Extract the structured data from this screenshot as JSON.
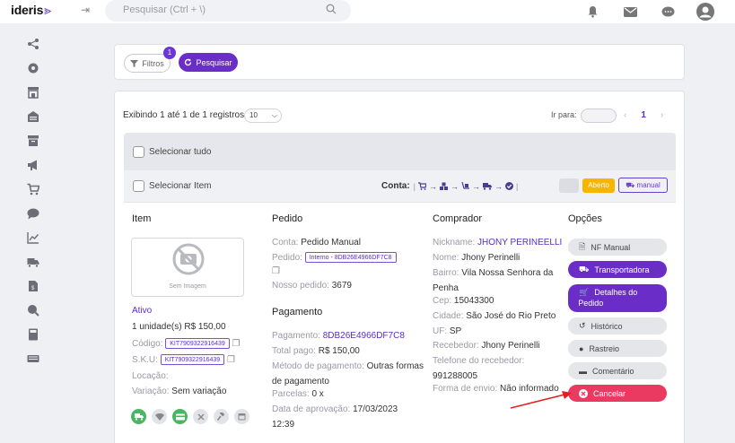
{
  "app": {
    "logo": "ideris"
  },
  "search": {
    "placeholder": "Pesquisar (Ctrl + \\)"
  },
  "filters": {
    "filtros_label": "Filtros",
    "filtros_count": "1",
    "pesquisar_label": "Pesquisar"
  },
  "results": {
    "showing": "Exibindo 1 até 1 de 1 registros",
    "per_page": "10",
    "ir_para_label": "Ir para:",
    "current_page": "1",
    "select_all_label": "Selecionar tudo",
    "select_item_label": "Selecionar Item",
    "conta_label": "Conta:",
    "status_aberto": "Aberto",
    "status_manual": "manual"
  },
  "item": {
    "heading": "Item",
    "no_image_caption": "Sem Imagem",
    "status": "Ativo",
    "quantity_price": "1 unidade(s) R$ 150,00",
    "codigo_label": "Código:",
    "codigo_value": "KIT7909322916439",
    "sku_label": "S.K.U:",
    "sku_value": "KIT7909322916439",
    "localizacao_label": "Locação:",
    "variacao_label": "Variação:",
    "variacao_value": "Sem variação"
  },
  "pedido": {
    "heading": "Pedido",
    "conta_label": "Conta:",
    "conta_value": "Pedido Manual",
    "pedido_label": "Pedido:",
    "pedido_value": "Interno - 8DB26E4966DF7C8",
    "nosso_label": "Nosso pedido:",
    "nosso_value": "3679"
  },
  "pagamento": {
    "heading": "Pagamento",
    "pag_label": "Pagamento:",
    "pag_value": "8DB26E4966DF7C8",
    "total_label": "Total pago:",
    "total_value": "R$ 150,00",
    "metodo_label": "Método de pagamento:",
    "metodo_value_1": "Outras formas",
    "metodo_value_2": "de pagamento",
    "parcelas_label": "Parcelas:",
    "parcelas_value": "0 x",
    "data_label": "Data de aprovação:",
    "data_value_1": "17/03/2023",
    "data_value_2": "12:39"
  },
  "comprador": {
    "heading": "Comprador",
    "nickname_label": "Nickname:",
    "nickname_value": "JHONY PERINEELLI",
    "nome_label": "Nome:",
    "nome_value": "Jhony Perinelli",
    "bairro_label": "Bairro:",
    "bairro_value_1": "Vila Nossa Senhora da",
    "bairro_value_2": "Penha",
    "cep_label": "Cep:",
    "cep_value": "15043300",
    "cidade_label": "Cidade:",
    "cidade_value": "São José do Rio Preto",
    "uf_label": "UF:",
    "uf_value": "SP",
    "recebedor_label": "Recebedor:",
    "recebedor_value": "Jhony Perinelli",
    "telefone_label": "Telefone do recebedor:",
    "telefone_value": "991288005",
    "envio_label": "Forma de envio:",
    "envio_value": "Não informado"
  },
  "opcoes": {
    "heading": "Opções",
    "nf_manual": "NF Manual",
    "transportadora": "Transportadora",
    "detalhes_1": "Detalhes do",
    "detalhes_2": "Pedido",
    "historico": "Histórico",
    "rastreio": "Rastreio",
    "comentario": "Comentário",
    "cancelar": "Cancelar"
  },
  "colors": {
    "accent": "#6a2dc8",
    "cancel": "#ea3a62",
    "aberto": "#f8b500",
    "annotation": "#e02020"
  }
}
